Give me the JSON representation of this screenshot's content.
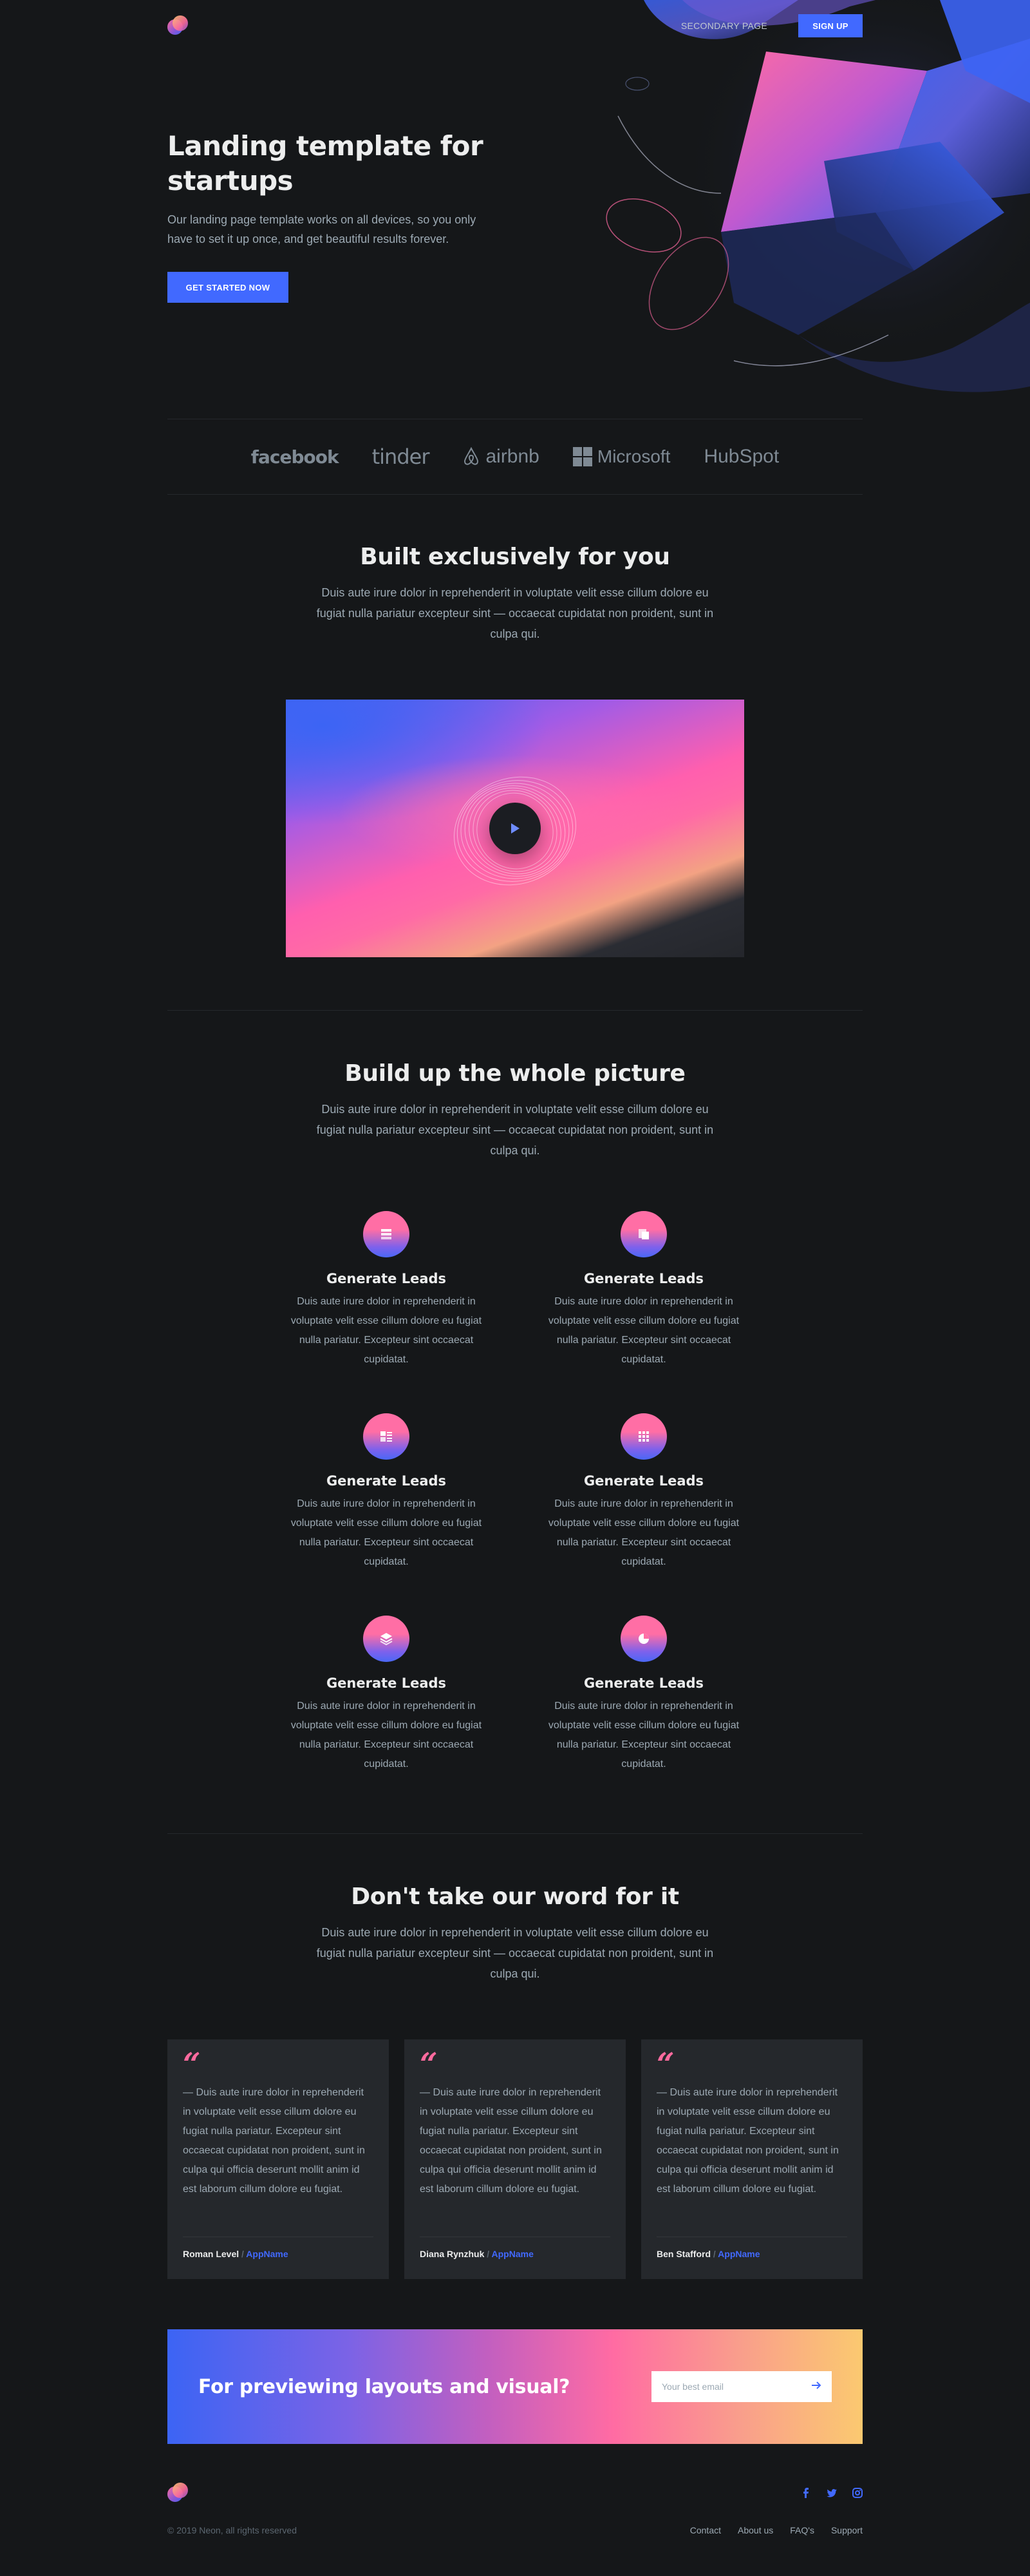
{
  "header": {
    "secondary_link": "SECONDARY PAGE",
    "signup_label": "SIGN UP"
  },
  "hero": {
    "title": "Landing template for startups",
    "subtitle": "Our landing page template works on all devices, so you only have to set it up once, and get beautiful results forever.",
    "cta_label": "GET STARTED NOW"
  },
  "clients": [
    "facebook",
    "tinder",
    "airbnb",
    "Microsoft",
    "HubSpot"
  ],
  "section1": {
    "title": "Built exclusively for you",
    "text": "Duis aute irure dolor in reprehenderit in voluptate velit esse cillum dolore eu fugiat nulla pariatur excepteur sint — occaecat cupidatat non proident, sunt in culpa qui."
  },
  "section2": {
    "title": "Build up the whole picture",
    "text": "Duis aute irure dolor in reprehenderit in voluptate velit esse cillum dolore eu fugiat nulla pariatur excepteur sint — occaecat cupidatat non proident, sunt in culpa qui."
  },
  "features": [
    {
      "icon": "list-icon",
      "title": "Generate Leads",
      "text": "Duis aute irure dolor in reprehenderit in voluptate velit esse cillum dolore eu fugiat nulla pariatur. Excepteur sint occaecat cupidatat."
    },
    {
      "icon": "copy-icon",
      "title": "Generate Leads",
      "text": "Duis aute irure dolor in reprehenderit in voluptate velit esse cillum dolore eu fugiat nulla pariatur. Excepteur sint occaecat cupidatat."
    },
    {
      "icon": "layout-icon",
      "title": "Generate Leads",
      "text": "Duis aute irure dolor in reprehenderit in voluptate velit esse cillum dolore eu fugiat nulla pariatur. Excepteur sint occaecat cupidatat."
    },
    {
      "icon": "grid-icon",
      "title": "Generate Leads",
      "text": "Duis aute irure dolor in reprehenderit in voluptate velit esse cillum dolore eu fugiat nulla pariatur. Excepteur sint occaecat cupidatat."
    },
    {
      "icon": "layers-icon",
      "title": "Generate Leads",
      "text": "Duis aute irure dolor in reprehenderit in voluptate velit esse cillum dolore eu fugiat nulla pariatur. Excepteur sint occaecat cupidatat."
    },
    {
      "icon": "pie-chart-icon",
      "title": "Generate Leads",
      "text": "Duis aute irure dolor in reprehenderit in voluptate velit esse cillum dolore eu fugiat nulla pariatur. Excepteur sint occaecat cupidatat."
    }
  ],
  "section3": {
    "title": "Don't take our word for it",
    "text": "Duis aute irure dolor in reprehenderit in voluptate velit esse cillum dolore eu fugiat nulla pariatur excepteur sint — occaecat cupidatat non proident, sunt in culpa qui."
  },
  "testimonials": [
    {
      "quote": "— Duis aute irure dolor in reprehenderit in voluptate velit esse cillum dolore eu fugiat nulla pariatur. Excepteur sint occaecat cupidatat non proident, sunt in culpa qui officia deserunt mollit anim id est laborum cillum dolore eu fugiat.",
      "name": "Roman Level",
      "sep": "/",
      "app": "AppName"
    },
    {
      "quote": "— Duis aute irure dolor in reprehenderit in voluptate velit esse cillum dolore eu fugiat nulla pariatur. Excepteur sint occaecat cupidatat non proident, sunt in culpa qui officia deserunt mollit anim id est laborum cillum dolore eu fugiat.",
      "name": "Diana Rynzhuk",
      "sep": "/",
      "app": "AppName"
    },
    {
      "quote": "— Duis aute irure dolor in reprehenderit in voluptate velit esse cillum dolore eu fugiat nulla pariatur. Excepteur sint occaecat cupidatat non proident, sunt in culpa qui officia deserunt mollit anim id est laborum cillum dolore eu fugiat.",
      "name": "Ben Stafford",
      "sep": "/",
      "app": "AppName"
    }
  ],
  "cta": {
    "title": "For previewing layouts and visual?",
    "email_placeholder": "Your best email"
  },
  "footer": {
    "copyright": "© 2019 Neon, all rights reserved",
    "links": [
      "Contact",
      "About us",
      "FAQ's",
      "Support"
    ],
    "social": [
      "facebook-icon",
      "twitter-icon",
      "instagram-icon"
    ]
  },
  "colors": {
    "background": "#151719",
    "accent": "#4169ff",
    "pink": "#ff6a9e",
    "card": "#25282c"
  }
}
